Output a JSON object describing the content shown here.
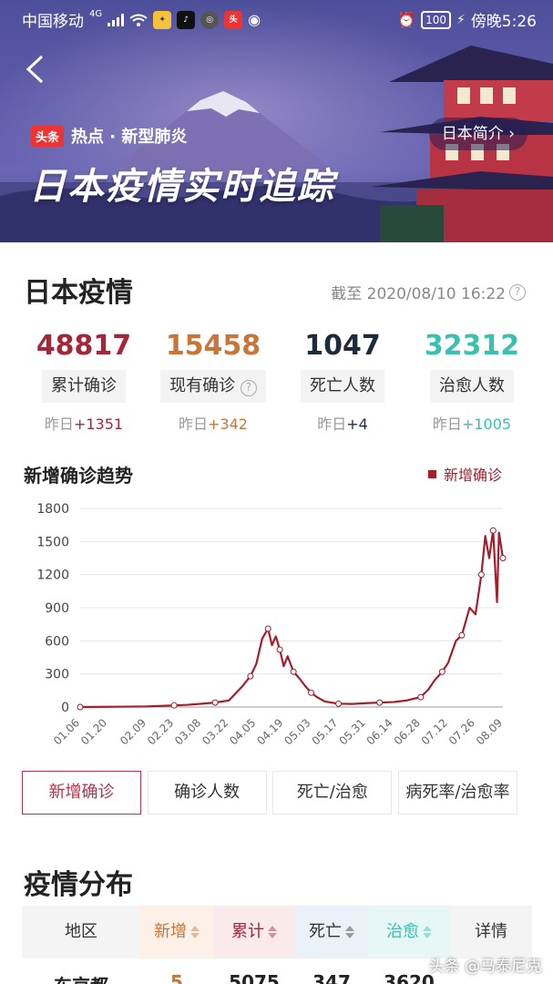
{
  "status_bar": {
    "carrier": "中国移动",
    "network": "4G",
    "time": "傍晚5:26",
    "battery": "100"
  },
  "header": {
    "tag_logo": "头条",
    "tag_text": "热点 · 新型肺炎",
    "intro_button": "日本简介",
    "title": "日本疫情实时追踪"
  },
  "overview": {
    "title": "日本疫情",
    "as_of": "截至 2020/08/10 16:22",
    "stats": [
      {
        "value": "48817",
        "label": "累计确诊",
        "delta_prefix": "昨日",
        "delta": "+1351",
        "color": "#a3263a"
      },
      {
        "value": "15458",
        "label": "现有确诊",
        "delta_prefix": "昨日",
        "delta": "+342",
        "color": "#c8753a"
      },
      {
        "value": "1047",
        "label": "死亡人数",
        "delta_prefix": "昨日",
        "delta": "+4",
        "color": "#1d2b3a"
      },
      {
        "value": "32312",
        "label": "治愈人数",
        "delta_prefix": "昨日",
        "delta": "+1005",
        "color": "#3bbfb1"
      }
    ]
  },
  "chart_data": {
    "type": "line",
    "title": "新增确诊趋势",
    "legend": "新增确诊",
    "legend_position": "top-right",
    "series_color": "#a31f2c",
    "grid": true,
    "ylim": [
      0,
      1800
    ],
    "y_ticks": [
      0,
      300,
      600,
      900,
      1200,
      1500,
      1800
    ],
    "x_ticks": [
      "01.06",
      "01.20",
      "02.09",
      "02.23",
      "03.08",
      "03.22",
      "04.05",
      "04.19",
      "05.03",
      "05.17",
      "05.31",
      "06.14",
      "06.28",
      "07.12",
      "07.26",
      "08.09"
    ],
    "series": [
      {
        "name": "新增确诊",
        "x": [
          "01.06",
          "01.20",
          "02.09",
          "02.23",
          "03.01",
          "03.08",
          "03.15",
          "03.22",
          "03.29",
          "04.02",
          "04.05",
          "04.08",
          "04.11",
          "04.13",
          "04.15",
          "04.17",
          "04.19",
          "04.21",
          "04.24",
          "04.27",
          "04.30",
          "05.03",
          "05.06",
          "05.10",
          "05.17",
          "05.24",
          "05.31",
          "06.07",
          "06.14",
          "06.21",
          "06.28",
          "07.02",
          "07.05",
          "07.09",
          "07.12",
          "07.16",
          "07.19",
          "07.23",
          "07.26",
          "07.29",
          "07.31",
          "08.02",
          "08.04",
          "08.06",
          "08.07",
          "08.09"
        ],
        "values": [
          0,
          2,
          5,
          15,
          20,
          30,
          40,
          60,
          190,
          280,
          390,
          620,
          710,
          560,
          640,
          520,
          370,
          460,
          320,
          260,
          190,
          130,
          90,
          50,
          30,
          28,
          35,
          40,
          45,
          60,
          90,
          160,
          240,
          320,
          400,
          600,
          650,
          900,
          840,
          1200,
          1550,
          1350,
          1600,
          950,
          1580,
          1350
        ]
      }
    ]
  },
  "tabs": [
    "新增确诊",
    "确诊人数",
    "死亡/治愈",
    "病死率/治愈率"
  ],
  "active_tab": 0,
  "distribution": {
    "title": "疫情分布",
    "columns": [
      {
        "label": "地区",
        "bg": "#f4f4f4",
        "color": "#333333",
        "sortable": false
      },
      {
        "label": "新增",
        "bg": "#fdf0e6",
        "color": "#c8753a",
        "sortable": true
      },
      {
        "label": "累计",
        "bg": "#fbeaec",
        "color": "#a3263a",
        "sortable": true
      },
      {
        "label": "死亡",
        "bg": "#ebf1f8",
        "color": "#333333",
        "sortable": true
      },
      {
        "label": "治愈",
        "bg": "#e6f7f5",
        "color": "#3bbfb1",
        "sortable": true
      },
      {
        "label": "详情",
        "bg": "#f4f4f4",
        "color": "#333333",
        "sortable": false
      }
    ],
    "rows": [
      {
        "region": "东京都",
        "new": "5",
        "total": "5075",
        "deaths": "347",
        "recovered": "3620"
      }
    ]
  },
  "watermark": "头条 @马泰尼克"
}
